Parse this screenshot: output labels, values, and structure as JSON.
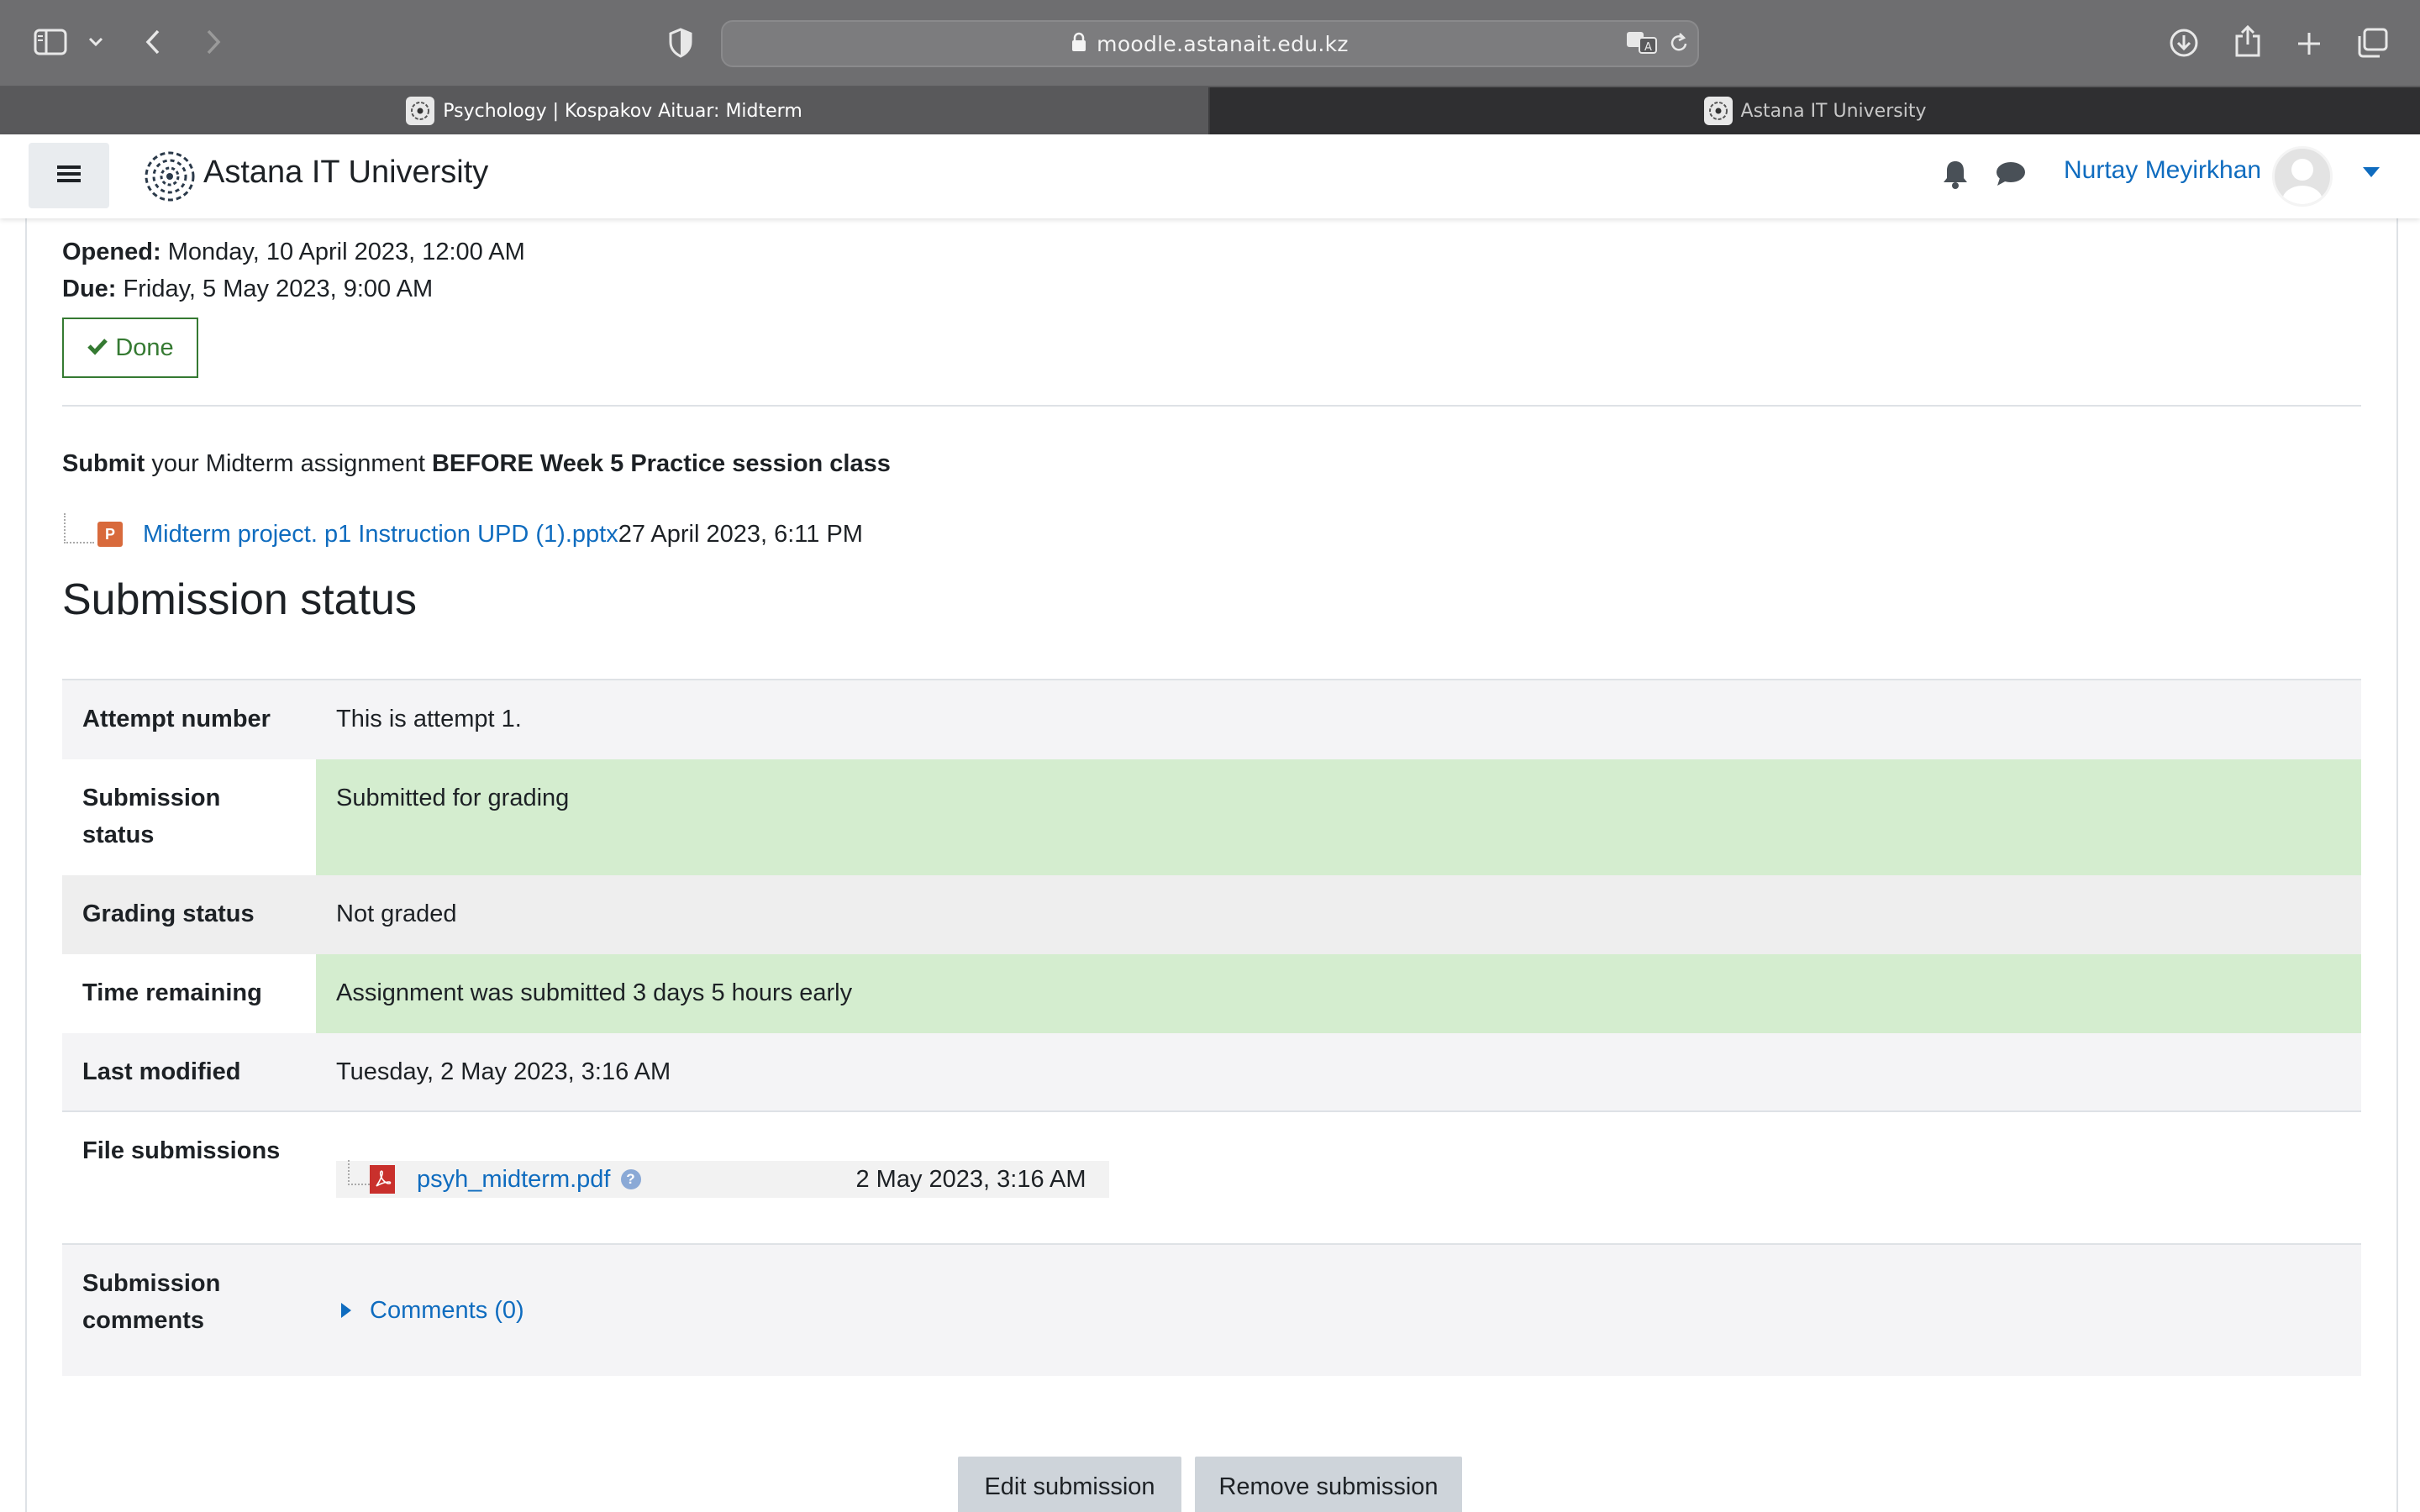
{
  "browser": {
    "url": "moodle.astanait.edu.kz",
    "tabs": [
      {
        "label": "Psychology | Kospakov Aituar: Midterm",
        "active": true
      },
      {
        "label": "Astana IT University",
        "active": false
      }
    ],
    "icons": [
      "sidebar-toggle-icon",
      "chevron-down-icon",
      "back-icon",
      "forward-icon",
      "shield-icon",
      "lock-icon",
      "translate-icon",
      "reload-icon",
      "download-icon",
      "share-icon",
      "new-tab-icon",
      "tab-overview-icon"
    ]
  },
  "navbar": {
    "site_name": "Astana IT University",
    "user_name": "Nurtay Meyirkhan",
    "icons": [
      "hamburger-icon",
      "bell-icon",
      "chat-icon",
      "avatar",
      "caret-down-icon"
    ]
  },
  "activity": {
    "opened_label": "Opened:",
    "opened_value": "Monday, 10 April 2023, 12:00 AM",
    "due_label": "Due:",
    "due_value": "Friday, 5 May 2023, 9:00 AM",
    "done_label": "Done",
    "intro": {
      "strong1": "Submit",
      "middle": " your Midterm assignment ",
      "strong2": "BEFORE Week 5 Practice session class"
    },
    "attachment": {
      "name": "Midterm project. p1 Instruction UPD (1).pptx",
      "date": "27 April 2023, 6:11 PM"
    }
  },
  "submission": {
    "heading": "Submission status",
    "rows": [
      {
        "label": "Attempt number",
        "value": "This is attempt 1."
      },
      {
        "label": "Submission status",
        "value": "Submitted for grading"
      },
      {
        "label": "Grading status",
        "value": "Not graded"
      },
      {
        "label": "Time remaining",
        "value": "Assignment was submitted 3 days 5 hours early"
      },
      {
        "label": "Last modified",
        "value": "Tuesday, 2 May 2023, 3:16 AM"
      },
      {
        "label": "File submissions",
        "file_name": "psyh_midterm.pdf",
        "file_date": "2 May 2023, 3:16 AM"
      },
      {
        "label": "Submission comments",
        "comments_link": "Comments (0)"
      }
    ]
  },
  "buttons": {
    "edit": "Edit submission",
    "remove": "Remove submission"
  },
  "colors": {
    "link": "#0f6cbf",
    "success_bg": "#d4edcf",
    "done_green": "#357a32",
    "button_bg": "#ced4da"
  }
}
